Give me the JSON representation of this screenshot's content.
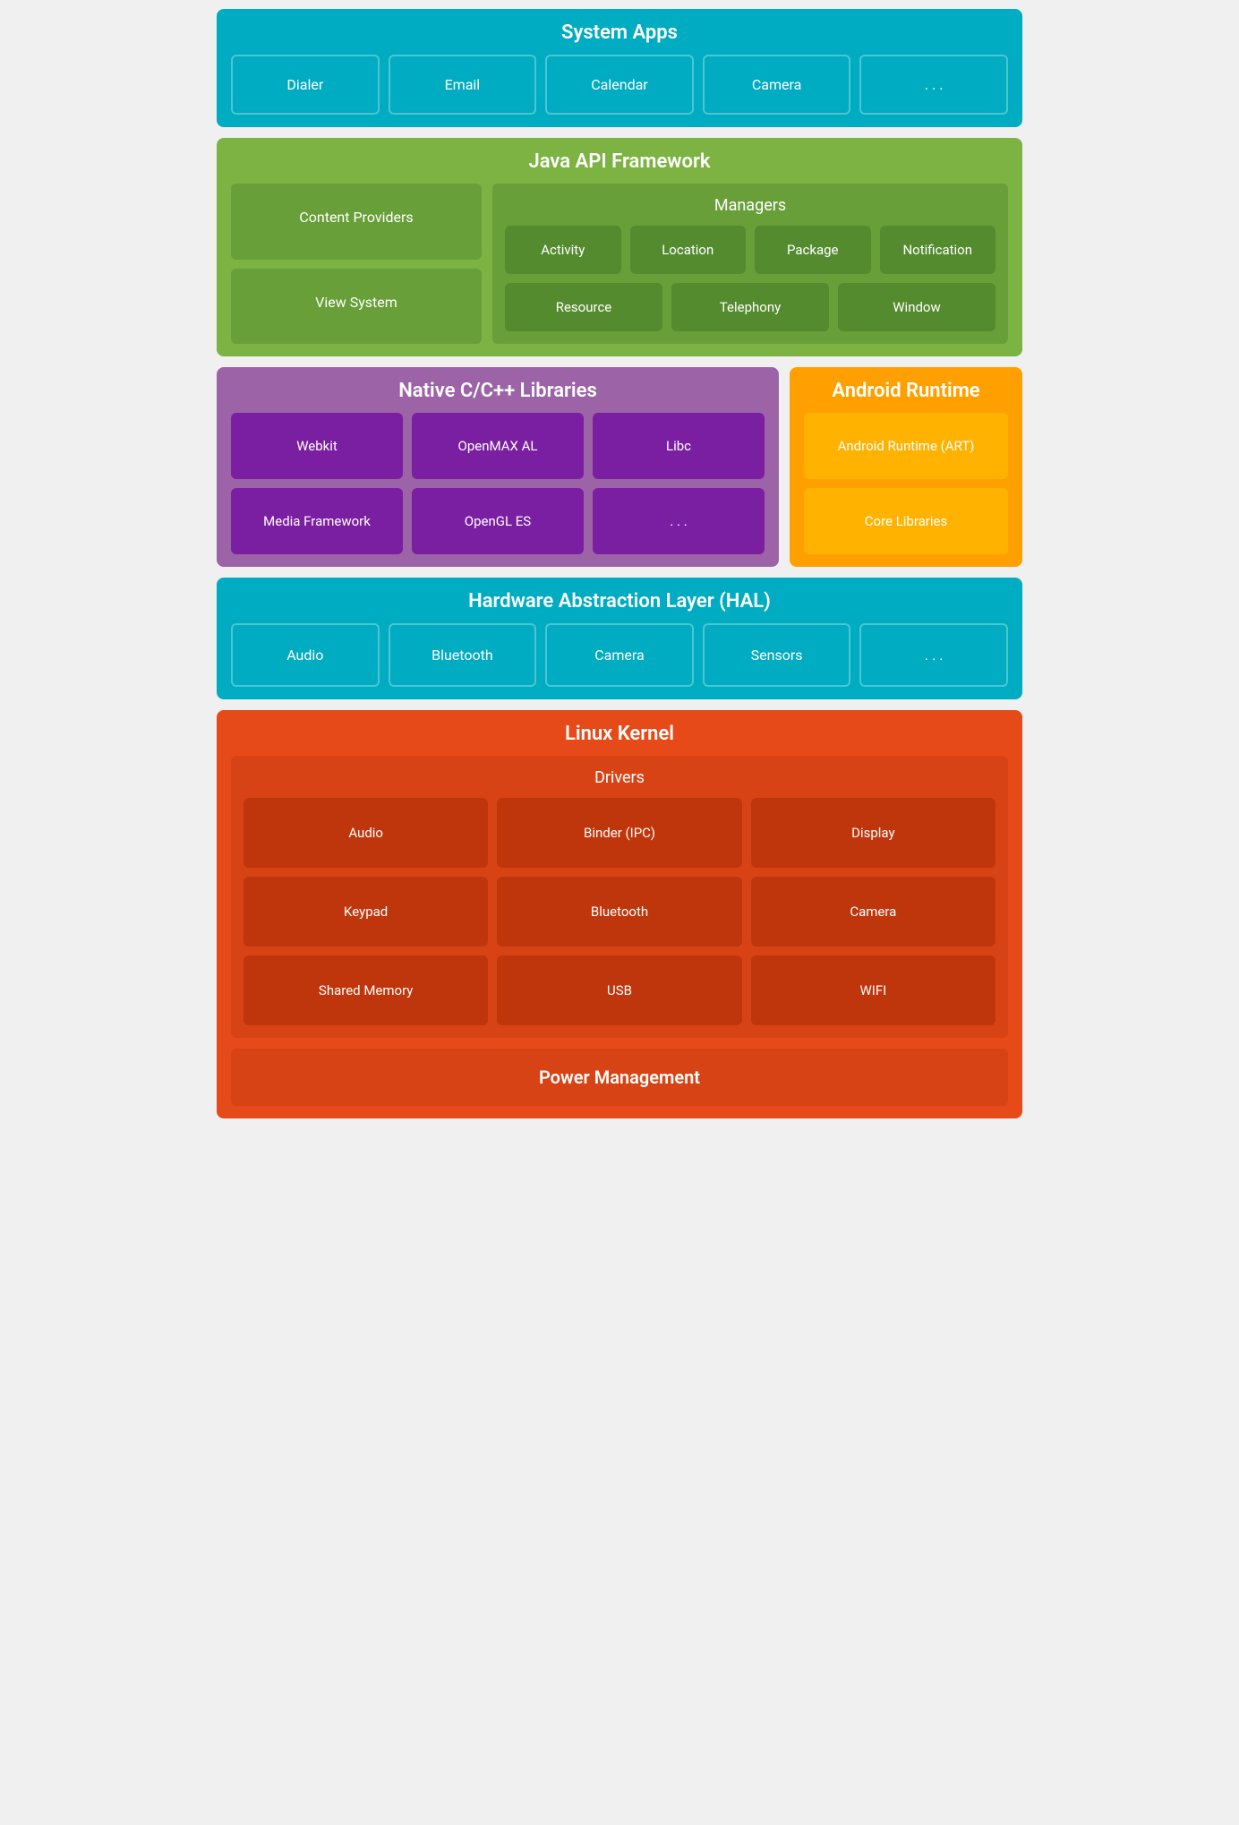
{
  "systemApps": {
    "title": "System Apps",
    "items": [
      "Dialer",
      "Email",
      "Calendar",
      "Camera",
      ". . ."
    ]
  },
  "javaApi": {
    "title": "Java API Framework",
    "contentProviders": "Content Providers",
    "viewSystem": "View System",
    "managers": {
      "title": "Managers",
      "row1": [
        "Activity",
        "Location",
        "Package",
        "Notification"
      ],
      "row2": [
        "Resource",
        "Telephony",
        "Window"
      ]
    }
  },
  "nativeLibs": {
    "title": "Native C/C++ Libraries",
    "items": [
      "Webkit",
      "OpenMAX AL",
      "Libc",
      "Media Framework",
      "OpenGL ES",
      ". . ."
    ]
  },
  "androidRuntime": {
    "title": "Android Runtime",
    "items": [
      "Android Runtime (ART)",
      "Core Libraries"
    ]
  },
  "hal": {
    "title": "Hardware Abstraction Layer (HAL)",
    "items": [
      "Audio",
      "Bluetooth",
      "Camera",
      "Sensors",
      ". . ."
    ]
  },
  "linuxKernel": {
    "title": "Linux Kernel",
    "drivers": {
      "title": "Drivers",
      "items": [
        "Audio",
        "Binder (IPC)",
        "Display",
        "Keypad",
        "Bluetooth",
        "Camera",
        "Shared Memory",
        "USB",
        "WIFI"
      ]
    },
    "powerManagement": "Power Management"
  }
}
